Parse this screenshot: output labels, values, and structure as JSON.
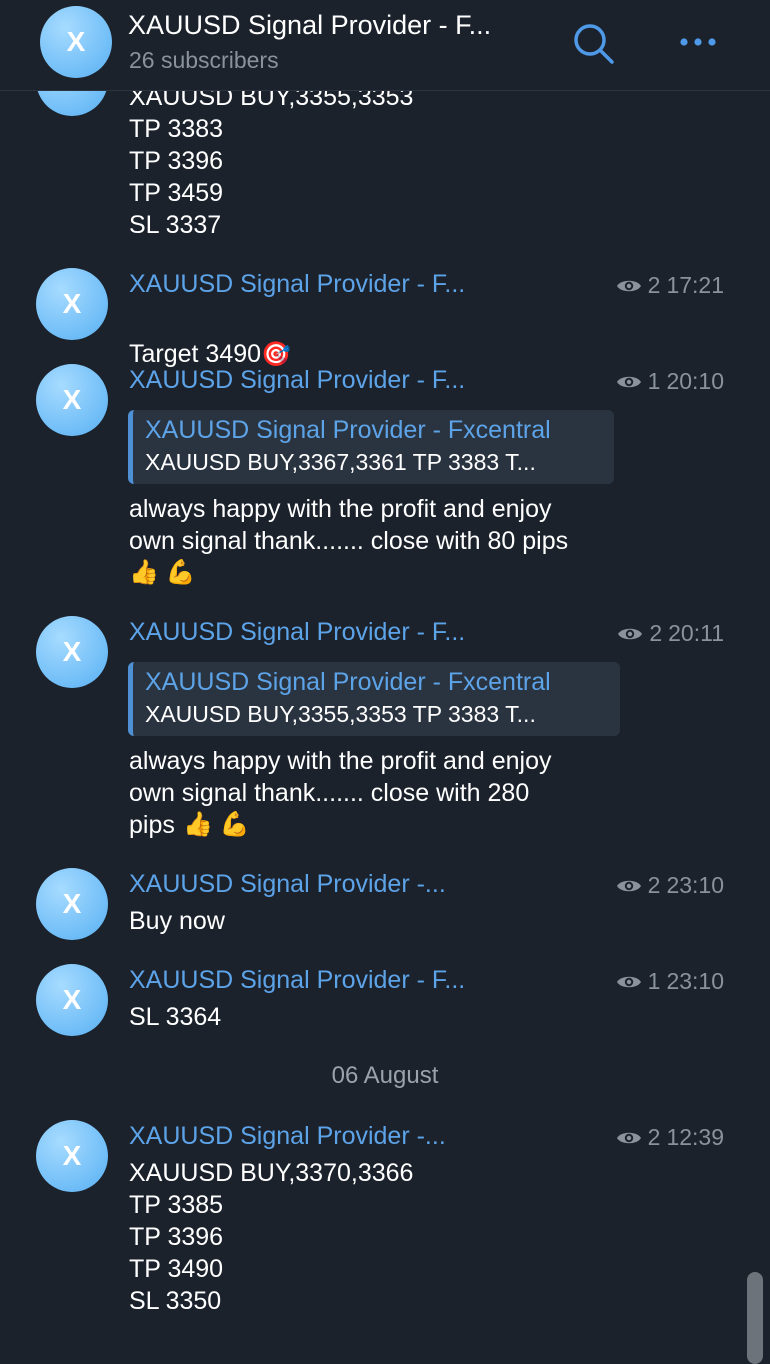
{
  "header": {
    "avatar_letter": "X",
    "title": "XAUUSD Signal Provider - F...",
    "subscribers": "26 subscribers"
  },
  "messages": [
    {
      "text": "XAUUSD BUY,3355,3353\nTP 3383\nTP 3396\nTP 3459\nSL 3337"
    },
    {
      "sender": "XAUUSD Signal Provider - F...",
      "views": "2",
      "time": "17:21",
      "text": "Target 3490",
      "emoji": "🎯"
    },
    {
      "sender": "XAUUSD Signal Provider - F...",
      "views": "1",
      "time": "20:10",
      "quote_title": "XAUUSD Signal Provider - Fxcentral",
      "quote_text": "XAUUSD BUY,3367,3361 TP 3383 T...",
      "text": "always happy with  the  profit and enjoy\nown signal thank....... close with 80 pips",
      "emoji": "👍 💪"
    },
    {
      "sender": "XAUUSD Signal Provider - F...",
      "views": "2",
      "time": "20:11",
      "quote_title": "XAUUSD Signal Provider - Fxcentral",
      "quote_text": "XAUUSD BUY,3355,3353 TP 3383 T...",
      "text": "always happy with  the  profit and enjoy\nown signal thank....... close with 280\npips",
      "emoji": "👍 💪"
    },
    {
      "sender": "XAUUSD Signal Provider -...",
      "views": "2",
      "time": "23:10",
      "text": "Buy now"
    },
    {
      "sender": "XAUUSD Signal Provider - F...",
      "views": "1",
      "time": "23:10",
      "text": "SL 3364"
    },
    {
      "sender": "XAUUSD Signal Provider -...",
      "views": "2",
      "time": "12:39",
      "text": "XAUUSD BUY,3370,3366\nTP 3385\nTP 3396\nTP 3490\nSL 3350"
    }
  ],
  "date_separator": "06 August",
  "icons": {
    "search": "search-icon",
    "more": "more-icon",
    "views": "eye-icon"
  },
  "colors": {
    "background": "#1b222c",
    "accent": "#5da3e8",
    "secondary_text": "#8a929c",
    "avatar": "#6fbdf7"
  }
}
